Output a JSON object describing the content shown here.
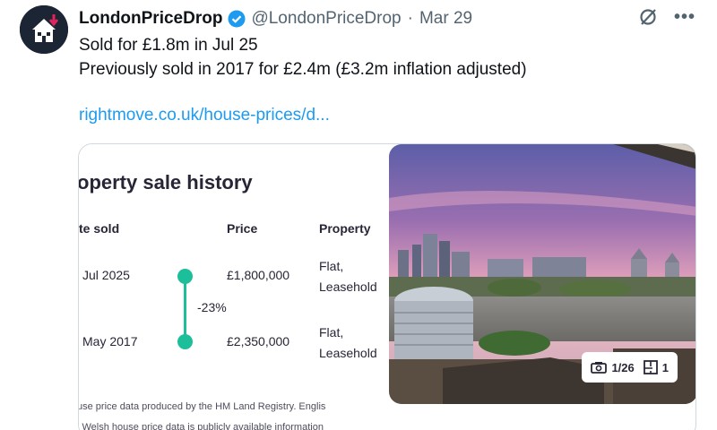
{
  "post": {
    "display_name": "LondonPriceDrop",
    "verified_icon": "verified-badge-icon",
    "handle": "@LondonPriceDrop",
    "separator": "·",
    "date": "Mar 29",
    "line1": "Sold for £1.8m in Jul 25",
    "line2": "Previously sold in 2017 for £2.4m (£3.2m inflation adjusted)",
    "link": "rightmove.co.uk/house-prices/d..."
  },
  "card": {
    "title": "operty sale history",
    "headers": {
      "date": "te sold",
      "price": "Price",
      "property": "Property"
    },
    "rows": [
      {
        "date": "Jul 2025",
        "price": "£1,800,000",
        "type": "Flat,",
        "tenure": "Leasehold"
      },
      {
        "date": "May 2017",
        "price": "£2,350,000",
        "type": "Flat,",
        "tenure": "Leasehold"
      }
    ],
    "change": "-23%",
    "footnote1": "use price data produced by the HM Land Registry. Englis",
    "footnote2": "l Welsh house price data is publicly available information",
    "photo_count": "1/26",
    "floorplan_count": "1"
  },
  "colors": {
    "accent": "#1dbf9a",
    "link": "#1d9bf0",
    "verified": "#1d9bf0"
  }
}
